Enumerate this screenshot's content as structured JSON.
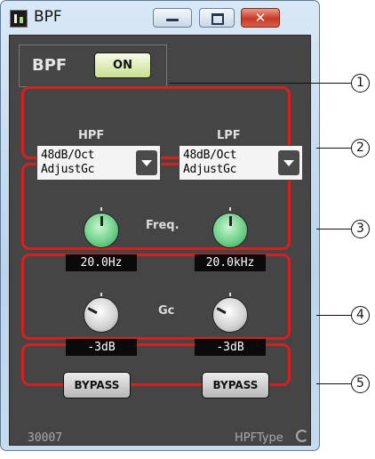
{
  "window": {
    "title": "BPF",
    "close_glyph": "✕",
    "icons": [
      "app-icon",
      "minimize-icon",
      "maximize-icon",
      "close-icon"
    ]
  },
  "bpf": {
    "label": "BPF",
    "on_button": "ON"
  },
  "filters": {
    "hpf": {
      "label": "HPF",
      "line1": "48dB/Oct",
      "line2": "AdjustGc"
    },
    "lpf": {
      "label": "LPF",
      "line1": "48dB/Oct",
      "line2": "AdjustGc"
    }
  },
  "freq": {
    "label": "Freq.",
    "hpf_value": "20.0Hz",
    "lpf_value": "20.0kHz"
  },
  "gc": {
    "label": "Gc",
    "hpf_value": "-3dB",
    "lpf_value": "-3dB"
  },
  "bypass": {
    "hpf_label": "BYPASS",
    "lpf_label": "BYPASS"
  },
  "footer": {
    "id": "30007",
    "type": "HPFType"
  },
  "callouts": [
    "1",
    "2",
    "3",
    "4",
    "5"
  ],
  "colors": {
    "highlight": "#d52020",
    "panel": "#454545",
    "knob_freq": "#6ed18b",
    "on_button": "#c9e08f"
  }
}
